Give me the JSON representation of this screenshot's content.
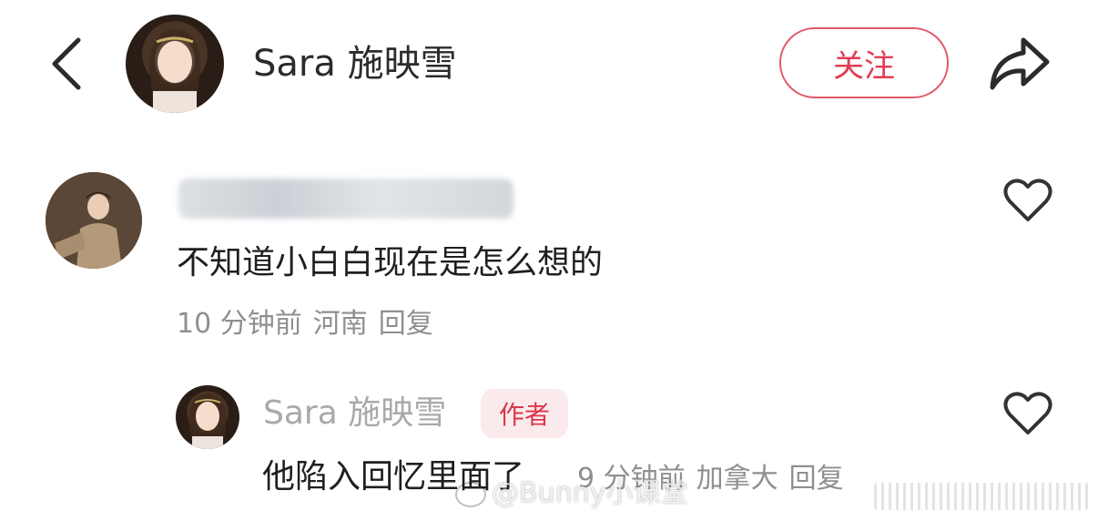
{
  "header": {
    "profile_name": "Sara 施映雪",
    "follow_label": "关注"
  },
  "comments": [
    {
      "username": "",
      "text": "不知道小白白现在是怎么想的",
      "time": "10 分钟前",
      "location": "河南",
      "reply_label": "回复"
    },
    {
      "username": "Sara 施映雪",
      "badge": "作者",
      "text": "他陷入回忆里面了",
      "time": "9 分钟前",
      "location": "加拿大",
      "reply_label": "回复"
    }
  ],
  "watermark": {
    "text": "@Bunny小课堂"
  },
  "colors": {
    "accent": "#e23c52",
    "meta_text": "#8f8f8f",
    "badge_bg": "#fbeaec"
  }
}
